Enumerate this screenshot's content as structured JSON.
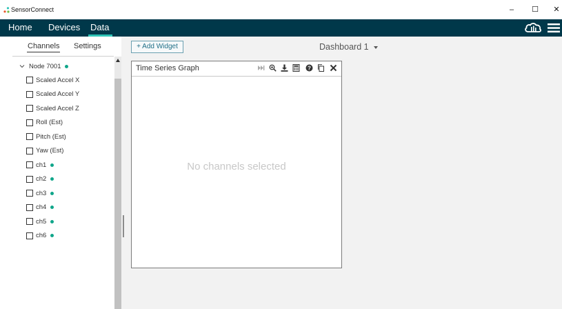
{
  "window": {
    "title": "SensorConnect",
    "minimize": "–",
    "maximize": "☐",
    "close": "✕"
  },
  "nav": {
    "home": "Home",
    "devices": "Devices",
    "data": "Data",
    "active_color": "#2ec4b6",
    "bar_color": "#00384a"
  },
  "sidebar": {
    "tabs": {
      "channels": "Channels",
      "settings": "Settings"
    },
    "node": {
      "label": "Node 7001",
      "status_color": "#10a68a"
    },
    "channels": [
      {
        "label": "Scaled Accel X",
        "checked": false,
        "active": false
      },
      {
        "label": "Scaled Accel Y",
        "checked": false,
        "active": false
      },
      {
        "label": "Scaled Accel Z",
        "checked": false,
        "active": false
      },
      {
        "label": "Roll (Est)",
        "checked": false,
        "active": false
      },
      {
        "label": "Pitch (Est)",
        "checked": false,
        "active": false
      },
      {
        "label": "Yaw (Est)",
        "checked": false,
        "active": false
      },
      {
        "label": "ch1",
        "checked": false,
        "active": true
      },
      {
        "label": "ch2",
        "checked": false,
        "active": true
      },
      {
        "label": "ch3",
        "checked": false,
        "active": true
      },
      {
        "label": "ch4",
        "checked": false,
        "active": true
      },
      {
        "label": "ch5",
        "checked": false,
        "active": true
      },
      {
        "label": "ch6",
        "checked": false,
        "active": true
      }
    ]
  },
  "dashboard": {
    "add_widget": "+ Add Widget",
    "title": "Dashboard 1"
  },
  "widget": {
    "title": "Time Series Graph",
    "empty_message": "No channels selected",
    "icons": [
      "skip-icon",
      "zoom-icon",
      "download-icon",
      "calculator-icon",
      "help-icon",
      "copy-icon",
      "close-icon"
    ]
  }
}
